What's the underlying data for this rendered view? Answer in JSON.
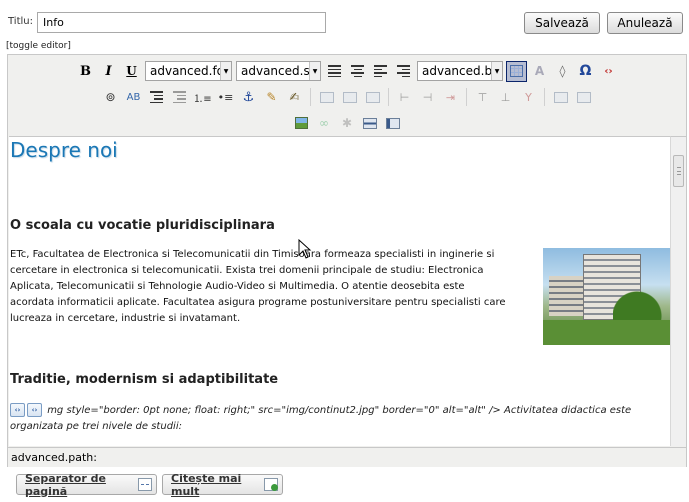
{
  "form": {
    "title_label": "Titlu:",
    "title_value": "Info",
    "save_label": "Salvează",
    "cancel_label": "Anulează",
    "toggle_editor": "[toggle editor]"
  },
  "toolbar": {
    "font_family": "advanced.fo",
    "font_size": "advanced.st",
    "block_format": "advanced.bl",
    "bold": "B",
    "italic": "I",
    "underline": "U",
    "charmap": "Ω"
  },
  "content": {
    "heading": "Despre noi",
    "section1_title": "O scoala cu vocatie pluridisciplinara",
    "section1_text": "ETc, Facultatea de Electronica si Telecomunicatii din Timisoara formeaza specialisti in inginerie si cercetare in electronica si telecomunicatii. Exista trei domenii principale de studiu: Electronica Aplicata, Telecomunicatii si Tehnologie Audio-Video si Multimedia. O atentie deosebita este acordata informaticii aplicate. Facultatea asigura programe postuniversitare pentru specialisti care lucreaza in cercetare, industrie si invatamant.",
    "section2_title": "Traditie, modernism si adaptibilitate",
    "section2_raw": "mg style=\"border: 0pt none; float: right;\" src=\"img/continut2.jpg\" border=\"0\" alt=\"alt\" /> Activitatea didactica este organizata pe trei nivele de studii:"
  },
  "status": {
    "path": "advanced.path:"
  },
  "buttons": {
    "page_break": "Separator de pagină",
    "read_more": "Citește mai mult"
  },
  "colors": {
    "heading": "#1a77b5",
    "toolbar_bg": "#f0f0ee"
  }
}
